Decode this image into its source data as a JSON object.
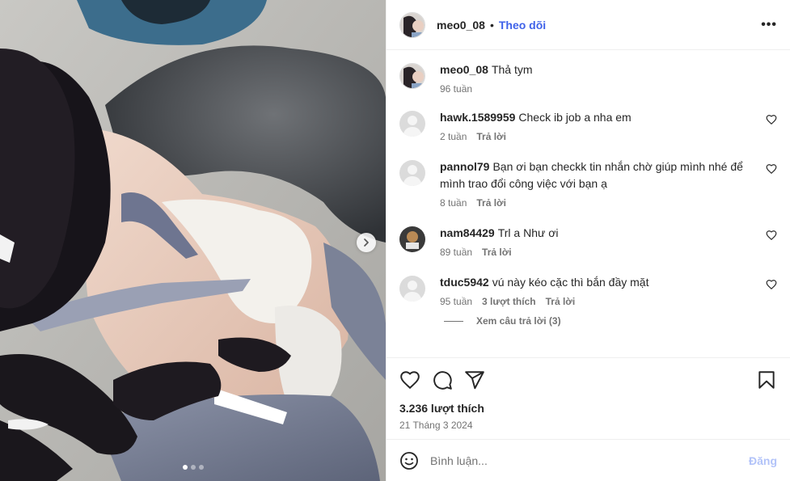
{
  "post": {
    "username": "meo0_08",
    "separator": "•",
    "follow_label": "Theo dõi",
    "more_label": "•••"
  },
  "comments": [
    {
      "user": "meo0_08",
      "text": "Thả tym",
      "time": "96 tuần"
    },
    {
      "user": "hawk.1589959",
      "text": "Check ib job a nha em",
      "time": "2 tuần",
      "reply_label": "Trả lời"
    },
    {
      "user": "pannol79",
      "text": "Bạn ơi bạn checkk tin nhắn chờ giúp mình nhé để mình trao đổi công việc với bạn ạ",
      "time": "8 tuần",
      "reply_label": "Trả lời"
    },
    {
      "user": "nam84429",
      "text": "Trl a Như ơi",
      "time": "89 tuần",
      "reply_label": "Trả lời"
    },
    {
      "user": "tduc5942",
      "text": "vú này kéo cặc thì bắn đầy mặt",
      "time": "95 tuần",
      "likes_label": "3 lượt thích",
      "reply_label": "Trả lời"
    }
  ],
  "view_replies_label": "Xem câu trả lời (3)",
  "likes_count": "3.236 lượt thích",
  "post_date": "21 Tháng 3 2024",
  "comment_input": {
    "placeholder": "Bình luận...",
    "value": ""
  },
  "post_button_label": "Đăng",
  "icons": {
    "like": "heart-icon",
    "comment": "comment-icon",
    "share": "send-icon",
    "save": "bookmark-icon",
    "emoji": "emoji-icon",
    "next": "chevron-right-icon"
  },
  "colors": {
    "accent": "#3f62e9",
    "post_disabled": "#b2c3f9",
    "secondary_text": "#737373",
    "primary_text": "#262626"
  }
}
